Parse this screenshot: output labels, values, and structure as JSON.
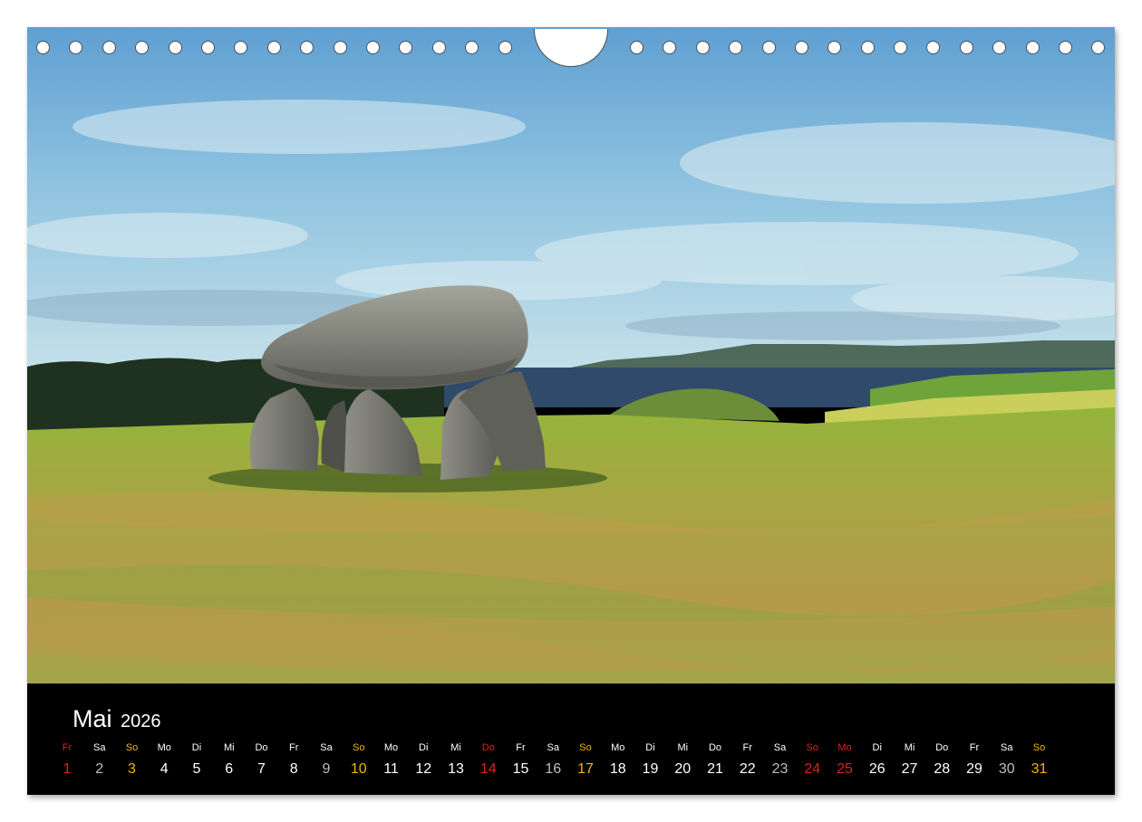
{
  "calendar": {
    "month": "Mai",
    "year": "2026",
    "colors": {
      "background": "#000000",
      "weekday": "#ffffff",
      "sunday": "#f2b600",
      "holiday": "#e0211c"
    },
    "days": [
      {
        "abbr": "Fr",
        "num": "1",
        "kind": "hol"
      },
      {
        "abbr": "Sa",
        "num": "2",
        "kind": "sat"
      },
      {
        "abbr": "So",
        "num": "3",
        "kind": "sun"
      },
      {
        "abbr": "Mo",
        "num": "4",
        "kind": "day"
      },
      {
        "abbr": "Di",
        "num": "5",
        "kind": "day"
      },
      {
        "abbr": "Mi",
        "num": "6",
        "kind": "day"
      },
      {
        "abbr": "Do",
        "num": "7",
        "kind": "day"
      },
      {
        "abbr": "Fr",
        "num": "8",
        "kind": "day"
      },
      {
        "abbr": "Sa",
        "num": "9",
        "kind": "sat"
      },
      {
        "abbr": "So",
        "num": "10",
        "kind": "sun"
      },
      {
        "abbr": "Mo",
        "num": "11",
        "kind": "day"
      },
      {
        "abbr": "Di",
        "num": "12",
        "kind": "day"
      },
      {
        "abbr": "Mi",
        "num": "13",
        "kind": "day"
      },
      {
        "abbr": "Do",
        "num": "14",
        "kind": "hol"
      },
      {
        "abbr": "Fr",
        "num": "15",
        "kind": "day"
      },
      {
        "abbr": "Sa",
        "num": "16",
        "kind": "sat"
      },
      {
        "abbr": "So",
        "num": "17",
        "kind": "sun"
      },
      {
        "abbr": "Mo",
        "num": "18",
        "kind": "day"
      },
      {
        "abbr": "Di",
        "num": "19",
        "kind": "day"
      },
      {
        "abbr": "Mi",
        "num": "20",
        "kind": "day"
      },
      {
        "abbr": "Do",
        "num": "21",
        "kind": "day"
      },
      {
        "abbr": "Fr",
        "num": "22",
        "kind": "day"
      },
      {
        "abbr": "Sa",
        "num": "23",
        "kind": "sat"
      },
      {
        "abbr": "So",
        "num": "24",
        "kind": "hol"
      },
      {
        "abbr": "Mo",
        "num": "25",
        "kind": "hol"
      },
      {
        "abbr": "Di",
        "num": "26",
        "kind": "day"
      },
      {
        "abbr": "Mi",
        "num": "27",
        "kind": "day"
      },
      {
        "abbr": "Do",
        "num": "28",
        "kind": "day"
      },
      {
        "abbr": "Fr",
        "num": "29",
        "kind": "day"
      },
      {
        "abbr": "Sa",
        "num": "30",
        "kind": "sat"
      },
      {
        "abbr": "So",
        "num": "31",
        "kind": "sun"
      }
    ]
  },
  "photo": {
    "subject": "dolmen-in-meadow",
    "colors": {
      "sky_top": "#5f9fd2",
      "sky_bottom": "#b9dbe8",
      "sea": "#2f4a6a",
      "meadow": "#8fa83c",
      "stone": "#7d7c72"
    }
  }
}
